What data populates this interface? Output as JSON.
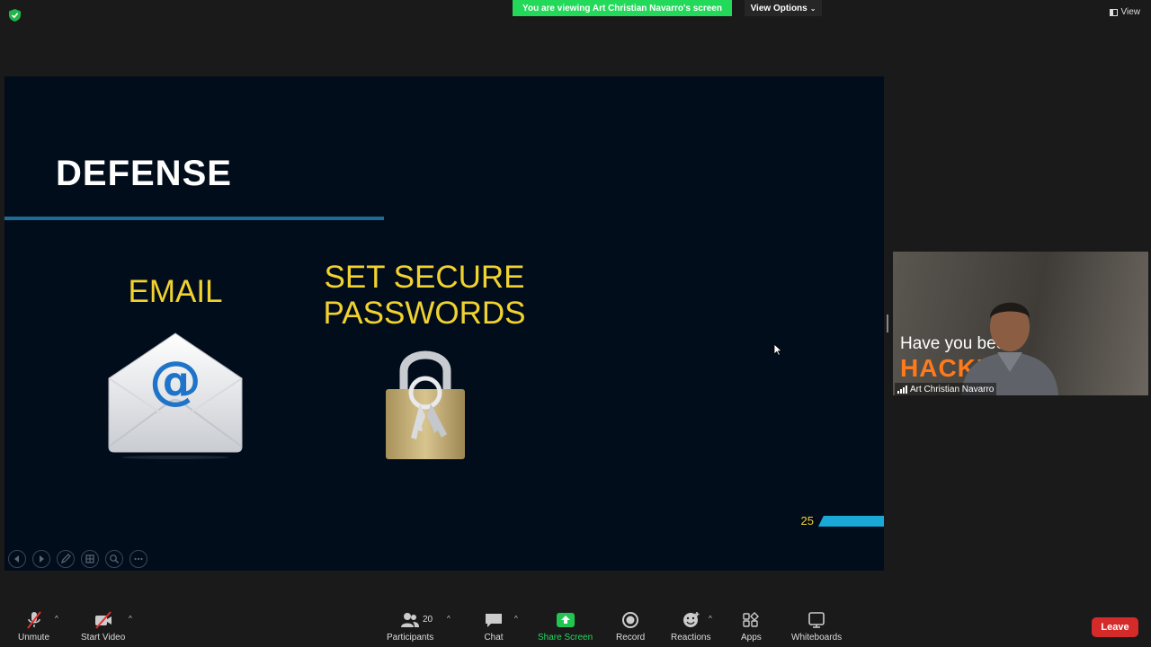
{
  "topbar": {
    "banner_text": "You are viewing Art Christian Navarro's screen",
    "view_options_label": "View Options",
    "view_label": "View",
    "banner_color": "#23d959"
  },
  "slide": {
    "title": "DEFENSE",
    "items": [
      {
        "heading": "EMAIL",
        "icon": "email-envelope-icon"
      },
      {
        "heading_line1": "SET SECURE",
        "heading_line2": "PASSWORDS",
        "icon": "padlock-keys-icon"
      }
    ],
    "page_number": "25",
    "accent_color": "#f2d22f",
    "background_color": "#020d1c"
  },
  "video": {
    "participant_name": "Art Christian Navarro",
    "overlay_text_line1": "Have you been",
    "overlay_text_line2": "HACKED"
  },
  "toolbar": {
    "unmute_label": "Unmute",
    "start_video_label": "Start Video",
    "participants_label": "Participants",
    "participants_count": "20",
    "chat_label": "Chat",
    "share_screen_label": "Share Screen",
    "record_label": "Record",
    "reactions_label": "Reactions",
    "apps_label": "Apps",
    "whiteboards_label": "Whiteboards",
    "leave_label": "Leave",
    "leave_color": "#d52a2a"
  }
}
